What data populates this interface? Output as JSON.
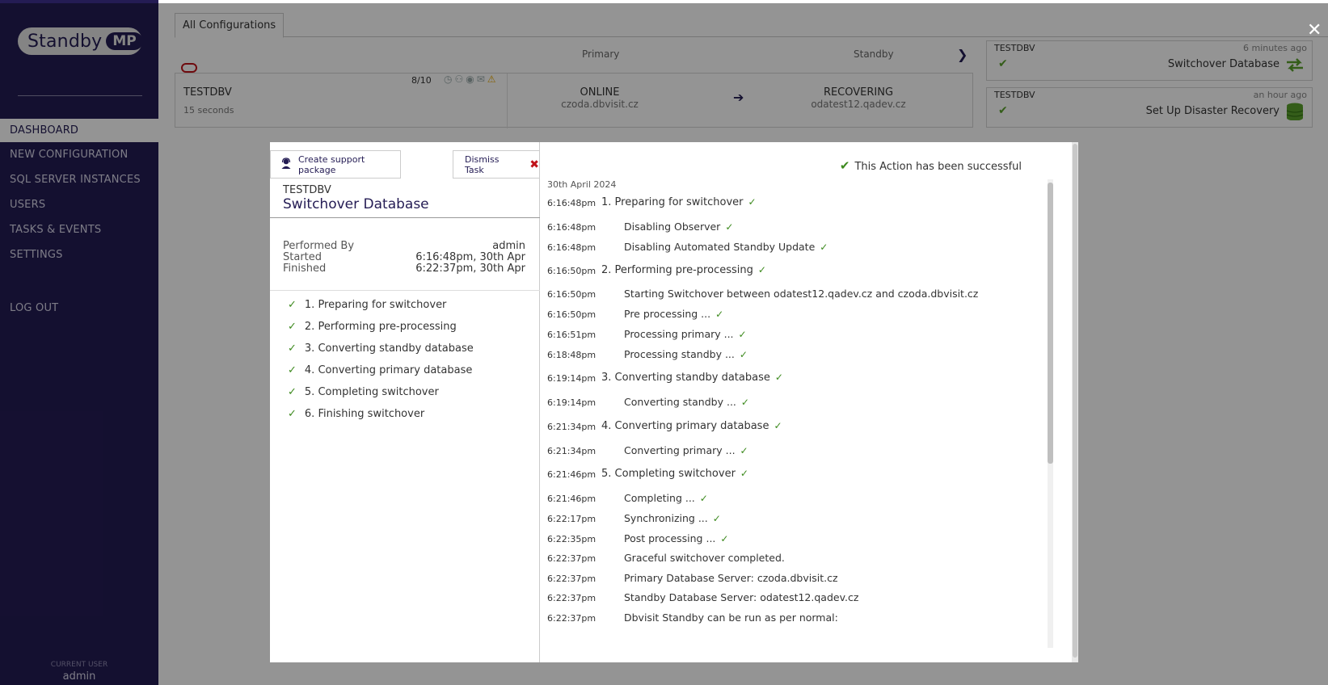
{
  "sidebar": {
    "logo_text": "Standby",
    "logo_badge": "MP",
    "nav": [
      "DASHBOARD",
      "NEW CONFIGURATION",
      "SQL SERVER INSTANCES",
      "USERS",
      "TASKS & EVENTS",
      "SETTINGS"
    ],
    "logout": "LOG OUT",
    "current_user_label": "CURRENT USER",
    "current_user": "admin"
  },
  "main": {
    "tab": "All Configurations",
    "col_primary": "Primary",
    "col_standby": "Standby",
    "config": {
      "name": "TESTDBV",
      "age": "15 seconds",
      "score": "8/10",
      "primary_status": "ONLINE",
      "primary_host": "czoda.dbvisit.cz",
      "standby_status": "RECOVERING",
      "standby_host": "odatest12.qadev.cz"
    },
    "tasks": [
      {
        "db": "TESTDBV",
        "time": "6 minutes ago",
        "title": "Switchover Database"
      },
      {
        "db": "TESTDBV",
        "time": "an hour ago",
        "title": "Set Up Disaster Recovery"
      }
    ]
  },
  "modal": {
    "support_btn": "Create support package",
    "dismiss_btn": "Dismiss Task",
    "db": "TESTDBV",
    "title": "Switchover Database",
    "performed_by_label": "Performed By",
    "performed_by": "admin",
    "started_label": "Started",
    "started": "6:16:48pm, 30th Apr",
    "finished_label": "Finished",
    "finished": "6:22:37pm, 30th Apr",
    "steps": [
      "1. Preparing for switchover",
      "2. Performing pre-processing",
      "3. Converting standby database",
      "4. Converting primary database",
      "5. Completing switchover",
      "6. Finishing switchover"
    ],
    "success_msg": "This Action has been successful",
    "log_date": "30th April 2024",
    "log": [
      {
        "time": "6:16:48pm",
        "msg": "1. Preparing for switchover",
        "kind": "stage",
        "ok": true
      },
      {
        "time": "6:16:48pm",
        "msg": "Disabling Observer",
        "kind": "sub",
        "ok": true
      },
      {
        "time": "6:16:48pm",
        "msg": "Disabling Automated Standby Update",
        "kind": "sub",
        "ok": true
      },
      {
        "time": "6:16:50pm",
        "msg": "2. Performing pre-processing",
        "kind": "stage",
        "ok": true
      },
      {
        "time": "6:16:50pm",
        "msg": "Starting Switchover between odatest12.qadev.cz and czoda.dbvisit.cz",
        "kind": "sub",
        "ok": false
      },
      {
        "time": "6:16:50pm",
        "msg": "Pre processing ...",
        "kind": "sub",
        "ok": true
      },
      {
        "time": "6:16:51pm",
        "msg": "Processing primary ...",
        "kind": "sub",
        "ok": true
      },
      {
        "time": "6:18:48pm",
        "msg": "Processing standby ...",
        "kind": "sub",
        "ok": true
      },
      {
        "time": "6:19:14pm",
        "msg": "3. Converting standby database",
        "kind": "stage",
        "ok": true
      },
      {
        "time": "6:19:14pm",
        "msg": "Converting standby ...",
        "kind": "sub",
        "ok": true
      },
      {
        "time": "6:21:34pm",
        "msg": "4. Converting primary database",
        "kind": "stage",
        "ok": true
      },
      {
        "time": "6:21:34pm",
        "msg": "Converting primary ...",
        "kind": "sub",
        "ok": true
      },
      {
        "time": "6:21:46pm",
        "msg": "5. Completing switchover",
        "kind": "stage",
        "ok": true
      },
      {
        "time": "6:21:46pm",
        "msg": "Completing ...",
        "kind": "sub",
        "ok": true
      },
      {
        "time": "6:22:17pm",
        "msg": "Synchronizing ...",
        "kind": "sub",
        "ok": true
      },
      {
        "time": "6:22:35pm",
        "msg": "Post processing ...",
        "kind": "sub",
        "ok": true
      },
      {
        "time": "6:22:37pm",
        "msg": "Graceful switchover completed.",
        "kind": "sub",
        "ok": false
      },
      {
        "time": "6:22:37pm",
        "msg": "Primary Database Server: czoda.dbvisit.cz",
        "kind": "sub",
        "ok": false
      },
      {
        "time": "6:22:37pm",
        "msg": "Standby Database Server: odatest12.qadev.cz",
        "kind": "sub",
        "ok": false
      },
      {
        "time": "6:22:37pm",
        "msg": "Dbvisit Standby can be run as per normal:",
        "kind": "sub",
        "ok": false
      }
    ]
  }
}
